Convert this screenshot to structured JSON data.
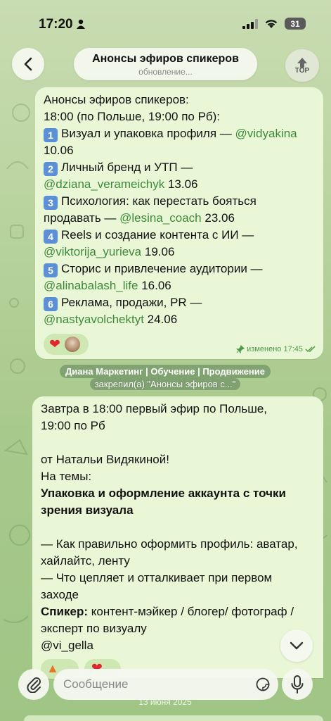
{
  "status_bar": {
    "time": "17:20",
    "battery": "31"
  },
  "header": {
    "title": "Анонсы эфиров спикеров",
    "subtitle": "обновление...",
    "top_label": "TOP"
  },
  "message1": {
    "lines": [
      "Анонсы эфиров спикеров:",
      "18:00 (по Польше, 19:00 по Рб):"
    ],
    "items": [
      {
        "num": "1",
        "text": "Визуал и упаковка профиля — ",
        "mention": "@vidyakina",
        "date": "10.06"
      },
      {
        "num": "2",
        "text": "Личный бренд и УТП — ",
        "mention": "@dziana_verameichyk",
        "date": " 13.06"
      },
      {
        "num": "3",
        "text": "Психология: как перестать бояться",
        "cont": "продавать — ",
        "mention": "@lesina_coach",
        "date": " 23.06"
      },
      {
        "num": "4",
        "text": "Reels и создание контента с ИИ — ",
        "mention": "@viktorija_yurieva",
        "date": " 19.06"
      },
      {
        "num": "5",
        "text": "Сторис и привлечение аудитории — ",
        "mention": "@alinabalash_life",
        "date": " 16.06"
      },
      {
        "num": "6",
        "text": "Реклама, продажи, PR — ",
        "mention": "@nastyavolchektyt",
        "date": " 24.06"
      }
    ],
    "meta": "изменено 17:45"
  },
  "service": {
    "name": "Диана Маркетинг | Обучение | Продвижение",
    "action": "закрепил(а) \"Анонсы эфиров с...\""
  },
  "message2": {
    "l1": "Завтра в 18:00 первый эфир по Польше,",
    "l2": "19:00 по Рб",
    "l3": " от Натальи Видякиной!",
    "l4": " На темы:",
    "l5": "Упаковка и оформление аккаунта с точки",
    "l6": "зрения визуала",
    "l7": "— Как правильно оформить профиль: аватар,",
    "l8": "хайлайтс, ленту",
    "l9": "— Что цепляет и отталкивает при первом",
    "l10": "заходе",
    "l11_bold": "Спикер:",
    "l11_rest": " контент-мэйкер / блогер/ фотограф /",
    "l12": "эксперт по визуалу",
    "l13": "@vi_gella"
  },
  "composer": {
    "placeholder": "Сообщение"
  },
  "date_chip": "13 июня 2025"
}
